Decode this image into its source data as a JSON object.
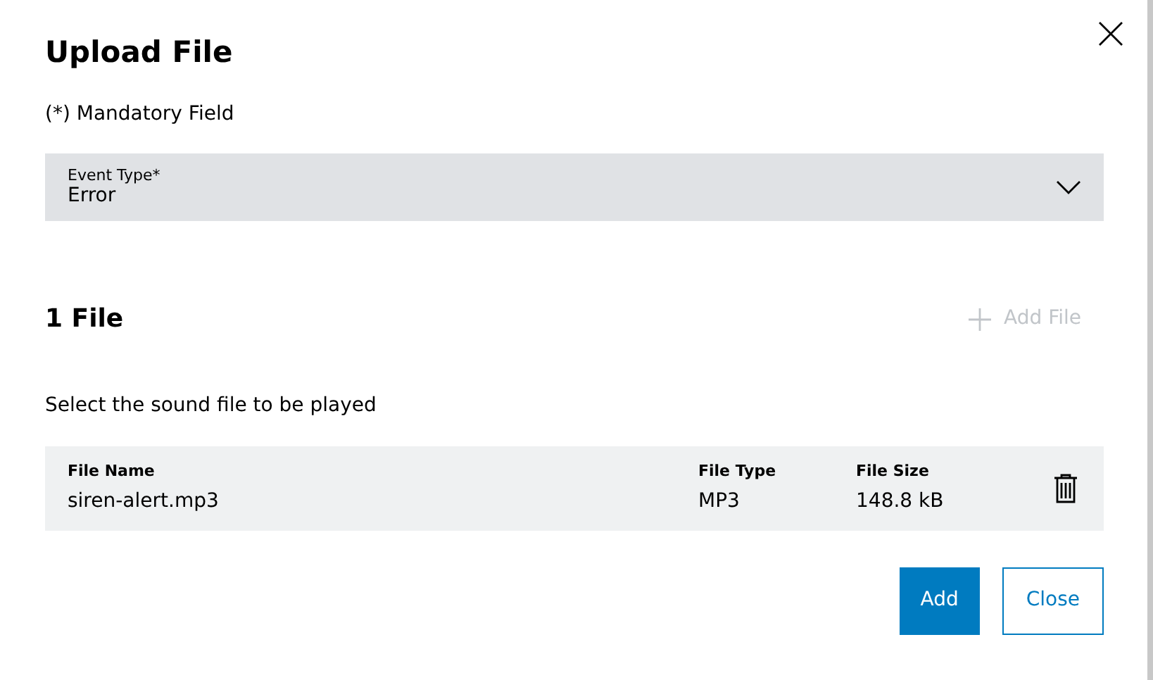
{
  "dialog": {
    "title": "Upload File",
    "note": "(*) Mandatory Field"
  },
  "event_type": {
    "label": "Event Type*",
    "value": "Error"
  },
  "files": {
    "heading": "1 File",
    "add_button": {
      "label": "Add File",
      "disabled": true
    },
    "instruction": "Select the sound file to be played",
    "columns": [
      "File Name",
      "File Type",
      "File Size"
    ],
    "rows": [
      [
        "siren-alert.mp3",
        "MP3",
        "148.8 kB"
      ]
    ]
  },
  "buttons": [
    {
      "label": "Add",
      "kind": "primary"
    },
    {
      "label": "Close",
      "kind": "secondary"
    }
  ]
}
